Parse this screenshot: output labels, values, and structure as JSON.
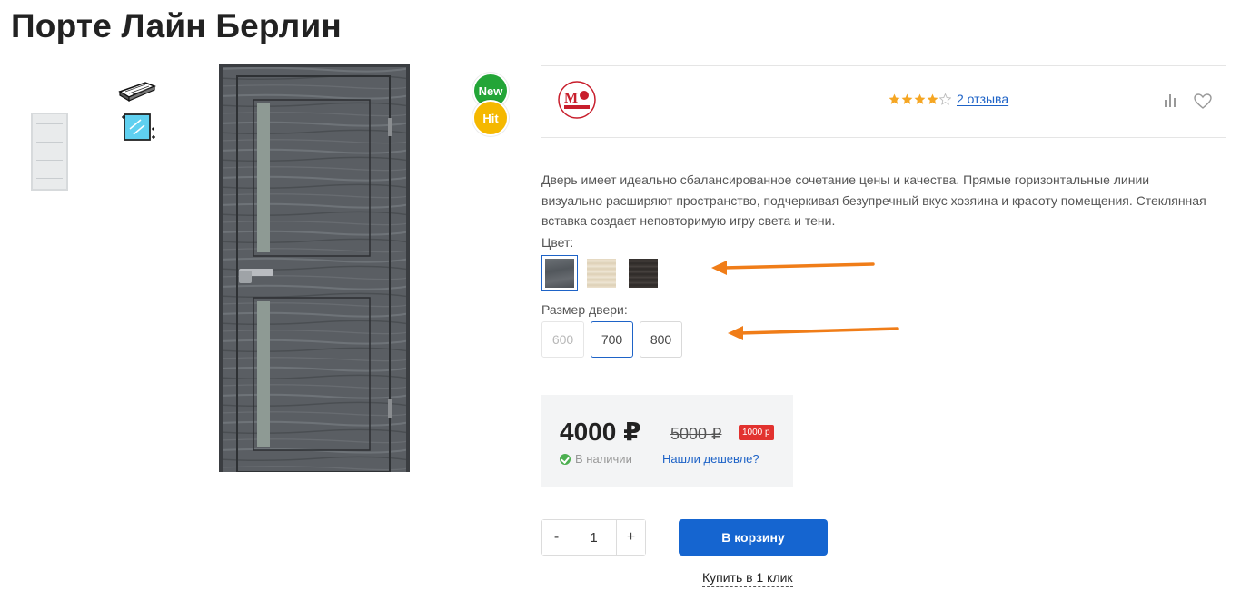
{
  "product": {
    "title": "Порте Лайн Берлин",
    "description": "Дверь имеет идеально сбалансированное сочетание цены и качества. Прямые горизонтальные линии визуально расширяют пространство, подчеркивая безупречный вкус хозяина и красоту помещения. Стеклянная вставка создает неповторимую игру света и тени."
  },
  "badges": {
    "new": "New",
    "hit": "Hit"
  },
  "brand": {
    "logo_icon": "brand-logo-m-style-icon"
  },
  "rating": {
    "stars": 4,
    "max": 5,
    "reviews_label": "2  отзыва"
  },
  "options": {
    "color_label": "Цвет:",
    "colors": [
      {
        "name": "grey-oak",
        "hex": "#5f6368",
        "selected": true
      },
      {
        "name": "light-oak",
        "hex": "#e6d9c2",
        "selected": false
      },
      {
        "name": "dark-wenge",
        "hex": "#3b3533",
        "selected": false
      }
    ],
    "size_label": "Размер двери:",
    "sizes": [
      {
        "label": "600",
        "state": "disabled"
      },
      {
        "label": "700",
        "state": "selected"
      },
      {
        "label": "800",
        "state": "available"
      }
    ]
  },
  "price": {
    "current": "4000 ₽",
    "old": "5000 ₽",
    "discount": "1000 р",
    "stock": "В наличии",
    "cheaper_link": "Нашли дешевле?"
  },
  "cart": {
    "minus": "-",
    "quantity": "1",
    "plus": "+",
    "add_button": "В корзину",
    "one_click": "Купить в 1 клик"
  },
  "icons": {
    "compare": "compare-bars-icon",
    "favorite": "heart-icon",
    "feature_1": "wood-plank-icon",
    "feature_2": "glass-pane-icon"
  },
  "colors": {
    "accent": "#1565d0",
    "link": "#1e63c7",
    "annotation_arrow": "#f07d18",
    "discount": "#e2322f"
  }
}
